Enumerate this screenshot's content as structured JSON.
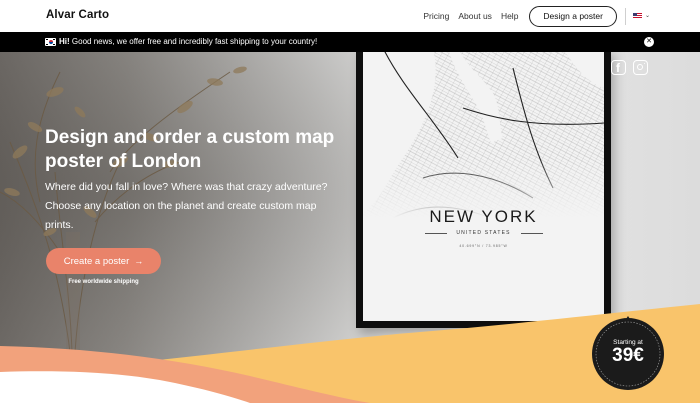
{
  "nav": {
    "brand": "Alvar Carto",
    "links": [
      "Pricing",
      "About us",
      "Help"
    ],
    "cta_label": "Design a poster",
    "language_chevron": "⌄"
  },
  "announcement": {
    "bold": "Hi!",
    "text": " Good news, we offer free and incredibly fast shipping to your country!",
    "close_icon": "close-icon",
    "close_glyph": "✕"
  },
  "hero": {
    "headline": "Design and order a custom map poster of London",
    "subline": "Where did you fall in love? Where was that crazy adventure? Choose any location on the planet and create custom map prints.",
    "cta_label": "Create a poster",
    "cta_arrow": "→",
    "shipping_note": "Free worldwide shipping"
  },
  "poster": {
    "city": "NEW YORK",
    "country": "UNITED STATES",
    "coords": "40.699°N / 73.985°W"
  },
  "social": {
    "facebook_glyph": "f",
    "icons": [
      "facebook-icon",
      "instagram-icon"
    ]
  },
  "badge": {
    "label": "Starting at",
    "price": "39€"
  },
  "colors": {
    "accent": "#e9836a",
    "wave_orange": "#f2a27c",
    "wave_yellow": "#f9c46b",
    "badge": "#1b1b1b"
  }
}
